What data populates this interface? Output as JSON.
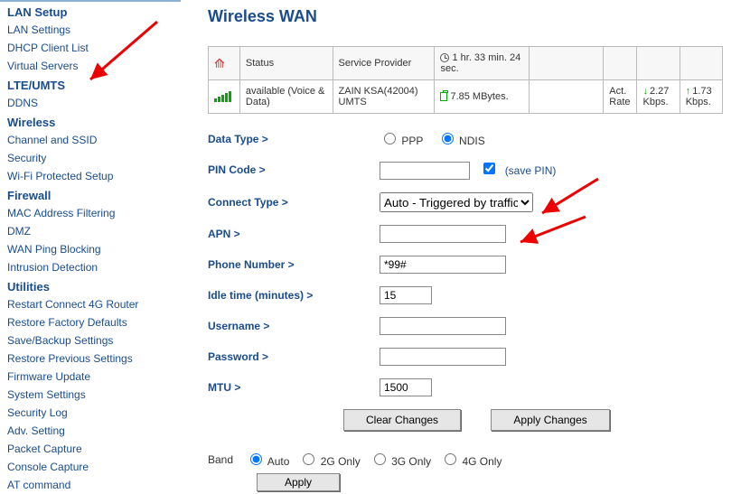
{
  "sidebar": {
    "groups": [
      {
        "header": "LAN Setup",
        "items": [
          "LAN Settings",
          "DHCP Client List",
          "Virtual Servers"
        ]
      },
      {
        "header": "LTE/UMTS",
        "items": [
          "DDNS"
        ]
      },
      {
        "header": "Wireless",
        "items": [
          "Channel and SSID",
          "Security",
          "Wi-Fi Protected Setup"
        ]
      },
      {
        "header": "Firewall",
        "items": [
          "MAC Address Filtering",
          "DMZ",
          "WAN Ping Blocking",
          "Intrusion Detection"
        ]
      },
      {
        "header": "Utilities",
        "items": [
          "Restart Connect 4G Router",
          "Restore Factory Defaults",
          "Save/Backup Settings",
          "Restore Previous Settings",
          "Firmware Update",
          "System Settings",
          "Security Log",
          "Adv. Setting",
          "Packet Capture",
          "Console Capture",
          "AT command"
        ]
      }
    ]
  },
  "page": {
    "title": "Wireless WAN"
  },
  "status": {
    "headers": {
      "status": "Status",
      "provider": "Service Provider",
      "uptime": "1 hr. 33 min. 24 sec.",
      "data": "",
      "rate": "",
      "down": "",
      "up": ""
    },
    "row": {
      "status": "available (Voice & Data)",
      "provider": "ZAIN KSA(42004) UMTS",
      "data": "7.85 MBytes.",
      "rate_label": "Act. Rate",
      "down": "2.27 Kbps.",
      "up": "1.73 Kbps."
    }
  },
  "form": {
    "data_type_label": "Data Type >",
    "ppp_label": "PPP",
    "ndis_label": "NDIS",
    "pin_label": "PIN Code >",
    "pin_value": "",
    "save_pin_label": "(save PIN)",
    "connect_type_label": "Connect Type >",
    "connect_type_value": "Auto - Triggered by traffic",
    "apn_label": "APN >",
    "apn_value": "",
    "phone_label": "Phone Number >",
    "phone_value": "*99#",
    "idle_label": "Idle time (minutes) >",
    "idle_value": "15",
    "username_label": "Username >",
    "username_value": "",
    "password_label": "Password >",
    "password_value": "",
    "mtu_label": "MTU >",
    "mtu_value": "1500",
    "clear_btn": "Clear Changes",
    "apply_btn": "Apply Changes"
  },
  "band": {
    "label": "Band",
    "auto": "Auto",
    "g2": "2G Only",
    "g3": "3G Only",
    "g4": "4G Only",
    "apply": "Apply"
  }
}
